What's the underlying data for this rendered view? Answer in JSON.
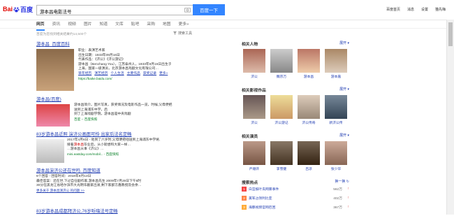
{
  "header": {
    "logo_left": "Bai",
    "logo_right": "百度",
    "query": "游本昌电影法号",
    "search_button": "百度一下",
    "links": [
      "百度首页",
      "消息",
      "设置",
      "猫先梅"
    ]
  },
  "nav": {
    "tabs": [
      "网页",
      "资讯",
      "视频",
      "图片",
      "知道",
      "文库",
      "贴吧",
      "采购",
      "地图",
      "更多»"
    ]
  },
  "tip": "百度为您找到相关结果约14,500个",
  "tools": "搜索工具",
  "results": [
    {
      "title": [
        "游本昌",
        "_百度百科"
      ],
      "lines": [
        "职业：表演艺术家",
        "出生日期：1933年09月16日",
        "代表作品：《济公》《济公游记》",
        "游本昌（Benchang You），江苏泰州人，1933年9月16日出生于",
        "上海，国家一级演员，北京游本昌戏剧文化有限公司…"
      ],
      "links": [
        "早年经历",
        "演艺经历",
        "个人生活",
        "主要作品",
        "获奖记录",
        "更多»"
      ],
      "url": "https://baike.baidu.com/"
    },
    {
      "title": [
        "游本昌",
        "(百度)"
      ],
      "lines": [
        "游本昌简介。图片写真，获奖情况及电影作品一览，时候,父母便把",
        "送到上海浦东中学，后",
        "到了上海戏剧学院，游本昌是中央戏剧",
        "国家话剧院,济公是他艺术生涯…"
      ],
      "url": "百度 -- 百度快照"
    },
    {
      "title": [
        "83岁",
        "游本昌",
        "近照 ",
        "演济公",
        "画面可怜 出家后",
        "法名",
        "定畅"
      ],
      "lines": [
        "2017年4月6日 - 他到了六岁时,父母便把他送到上海浦东中学将,",
        "接着",
        "游本昌",
        "毕业后，从小就想和大家一样…",
        "…游本昌从事《济公》…"
      ],
      "url": "mini.eastday.com/mobil... - 百度快照"
    },
    {
      "title": [
        "游本昌",
        "演济公还在世吗_百度知道"
      ],
      "lines": [
        "6个回答 - 回答时间：2018年8月13日",
        "最佳答案：还在世,下过自任剧作家,游本昌先生 2009年7月28日下午5时",
        "30分在黑龙江省哈尔滨市大光明华剧家出发,剩下家部方鑫教授及会余…"
      ],
      "url": "更多关于 游本昌演济公 的问题 >>"
    },
    {
      "title": [
        "83岁",
        "游本昌",
        "成都拜济公,76岁听嗨",
        "法号",
        "定畅"
      ],
      "lines": []
    }
  ],
  "right": {
    "people": {
      "title": "相关人物",
      "more": "展开",
      "names": [
        "济公",
        "魏宗万",
        "游本昌",
        "游本嘉"
      ]
    },
    "films": {
      "title": "相关影视作品",
      "more": "展开",
      "names": [
        "济公",
        "济公游记",
        "济公传奇",
        "新济公传"
      ]
    },
    "actors": {
      "title": "相关演员",
      "more": "展开",
      "names": [
        "严顺开",
        "李雪健",
        "吕凉",
        "张少华"
      ]
    },
    "hot": {
      "title": "搜索热点",
      "more": "换一换",
      "items": [
        {
          "n": "1",
          "t": "白宫报叶氏网暴事件",
          "v": "562万",
          "c": "#f54545"
        },
        {
          "n": "2",
          "t": "美军占领利比亚",
          "v": "402万",
          "c": "#ff8547"
        },
        {
          "n": "3",
          "t": "海豚视频官网召回",
          "v": "367万",
          "c": "#ffac38"
        }
      ]
    }
  }
}
